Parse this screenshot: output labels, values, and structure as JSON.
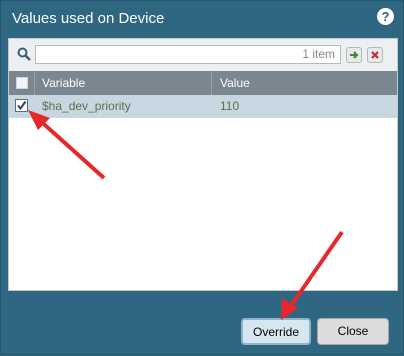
{
  "dialog": {
    "title": "Values used on Device",
    "help_icon": "question-mark-icon"
  },
  "search": {
    "placeholder": "",
    "count_text": "1 item",
    "search_icon": "magnifier-icon",
    "apply_icon": "arrow-right-icon",
    "clear_icon": "clear-x-icon"
  },
  "table": {
    "columns": [
      "",
      "Variable",
      "Value"
    ],
    "rows": [
      {
        "checked": true,
        "variable": "$ha_dev_priority",
        "value": "110"
      }
    ]
  },
  "buttons": {
    "override": "Override",
    "close": "Close"
  },
  "colors": {
    "dialog_bg": "#2f6783",
    "header_bg": "#7a8690",
    "selected_row_bg": "#c7d7e2",
    "annotation_red": "#e8272a"
  }
}
